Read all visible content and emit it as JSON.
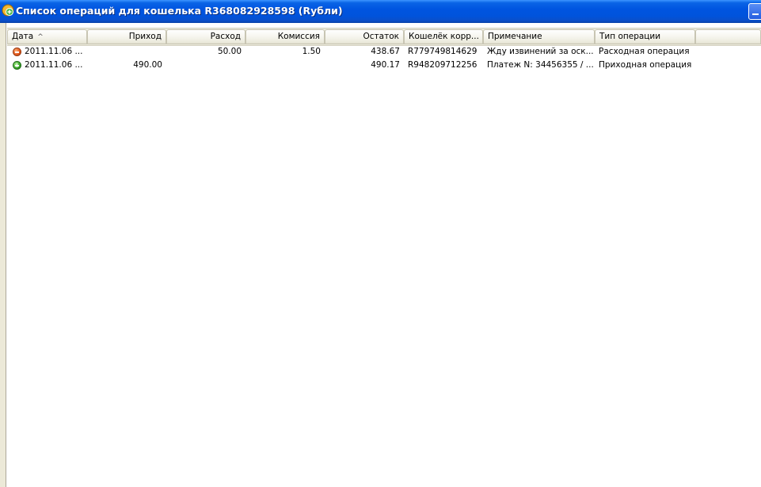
{
  "window": {
    "title": "Список операций для кошелька R368082928598 (Rубли)"
  },
  "table": {
    "columns": [
      {
        "label": "Дата",
        "sorted": "ascending"
      },
      {
        "label": "Приход"
      },
      {
        "label": "Расход"
      },
      {
        "label": "Комиссия"
      },
      {
        "label": "Остаток"
      },
      {
        "label": "Кошелёк корр..."
      },
      {
        "label": "Примечание"
      },
      {
        "label": "Тип операции"
      }
    ],
    "sort_indicator": "^",
    "rows": [
      {
        "icon": "expense-minus-icon",
        "date": "2011.11.06 ...",
        "income": "",
        "expense": "50.00",
        "commission": "1.50",
        "balance": "438.67",
        "wallet": "R779749814629",
        "note": "Жду извинений за оск...",
        "type": "Расходная операция"
      },
      {
        "icon": "income-plus-icon",
        "date": "2011.11.06 ...",
        "income": "490.00",
        "expense": "",
        "commission": "",
        "balance": "490.17",
        "wallet": "R948209712256",
        "note": "Платеж N: 34456355 / ...",
        "type": "Приходная операция"
      }
    ]
  },
  "colors": {
    "titlebar": "#0055e0",
    "expense_icon": "#e0561a",
    "income_icon": "#3aa52a"
  }
}
